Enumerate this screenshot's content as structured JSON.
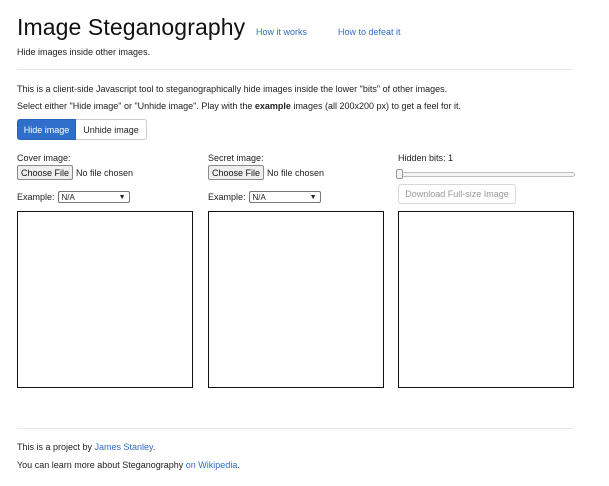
{
  "header": {
    "title": "Image Steganography",
    "nav": [
      {
        "label": "How it works"
      },
      {
        "label": "How to defeat it"
      }
    ],
    "subtitle": "Hide images inside other images."
  },
  "intro": {
    "line1": "This is a client-side Javascript tool to steganographically hide images inside the lower \"bits\" of other images.",
    "line2_before": "Select either \"Hide image\" or \"Unhide image\". Play with the ",
    "line2_bold": "example",
    "line2_after": " images (all 200x200 px) to get a feel for it."
  },
  "mode_buttons": {
    "hide": "Hide image",
    "unhide": "Unhide image",
    "active": "hide"
  },
  "cover": {
    "label": "Cover image:",
    "file_button": "Choose File",
    "file_status": "No file chosen",
    "example_label": "Example:",
    "example_value": "N/A"
  },
  "secret": {
    "label": "Secret image:",
    "file_button": "Choose File",
    "file_status": "No file chosen",
    "example_label": "Example:",
    "example_value": "N/A"
  },
  "output": {
    "hidden_bits_label": "Hidden bits: 1",
    "hidden_bits_value": 1,
    "download_button": "Download Full-size Image"
  },
  "footer": {
    "line1_before": "This is a project by ",
    "line1_link": "James Stanley",
    "line1_after": ".",
    "line2_before": "You can learn more about Steganography ",
    "line2_link": "on Wikipedia",
    "line2_after": "."
  },
  "colors": {
    "accent": "#2f6ecb",
    "text": "#222222"
  }
}
